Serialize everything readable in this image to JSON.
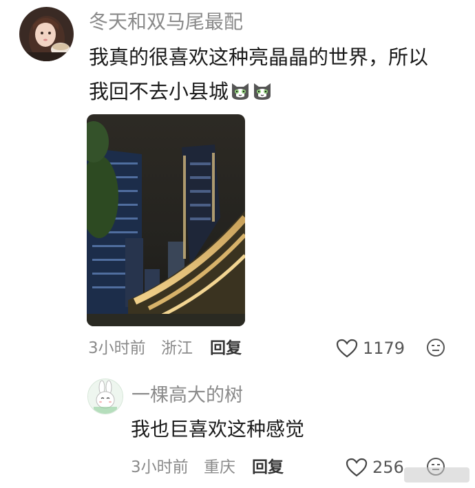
{
  "comment": {
    "username": "冬天和双马尾最配",
    "text_line1": "我真的很喜欢这种亮晶晶的世界，所以",
    "text_line2": "我回不去小县城",
    "emoji_icons": [
      "cat-face-icon",
      "cat-face-icon"
    ],
    "time": "3小时前",
    "location": "浙江",
    "reply_label": "回复",
    "like_count": "1179"
  },
  "reply": {
    "username": "一棵高大的树",
    "text": "我也巨喜欢这种感觉",
    "time": "3小时前",
    "location": "重庆",
    "reply_label": "回复",
    "like_count": "256"
  },
  "colors": {
    "username": "#8a8a8a",
    "text": "#1a1a1a",
    "meta": "#8a8a8a",
    "background": "#ffffff"
  }
}
